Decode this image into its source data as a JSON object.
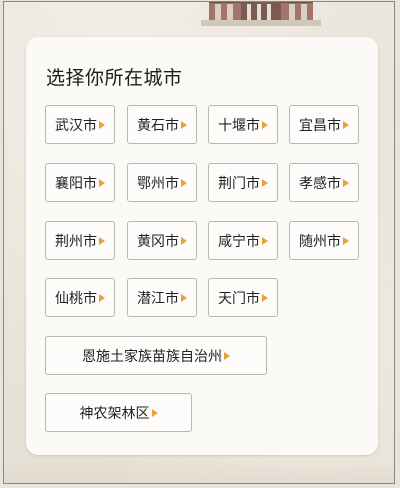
{
  "header": {
    "title": "选择你所在城市"
  },
  "cities": [
    {
      "label": "武汉市"
    },
    {
      "label": "黄石市"
    },
    {
      "label": "十堰市"
    },
    {
      "label": "宜昌市"
    },
    {
      "label": "襄阳市"
    },
    {
      "label": "鄂州市"
    },
    {
      "label": "荆门市"
    },
    {
      "label": "孝感市"
    },
    {
      "label": "荆州市"
    },
    {
      "label": "黄冈市"
    },
    {
      "label": "咸宁市"
    },
    {
      "label": "随州市"
    },
    {
      "label": "仙桃市"
    },
    {
      "label": "潜江市"
    },
    {
      "label": "天门市"
    },
    {
      "label": "恩施土家族苗族自治州"
    },
    {
      "label": "神农架林区"
    }
  ],
  "colors": {
    "arrow": "#e8a23a",
    "card": "#fbfaf7",
    "border": "#b9b6b0"
  },
  "icons": {
    "arrow": "caret-right-icon"
  }
}
